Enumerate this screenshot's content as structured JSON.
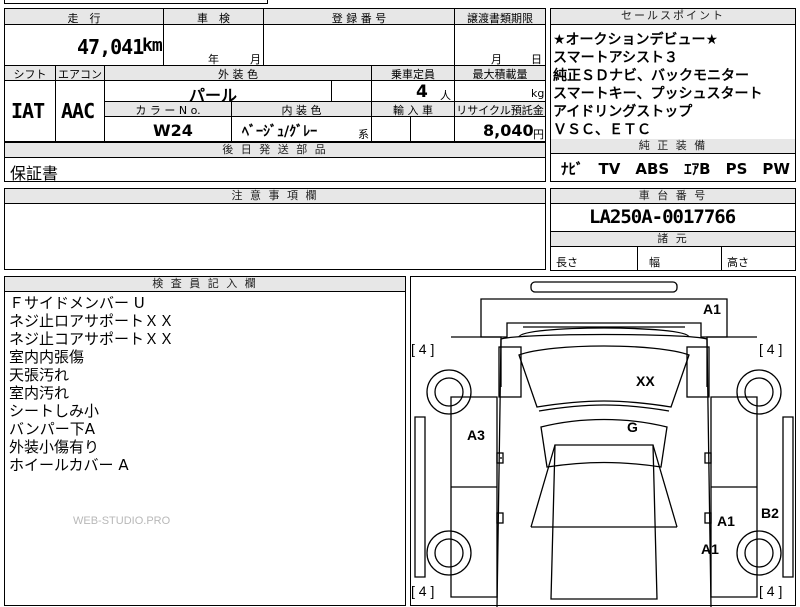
{
  "top_row": {
    "mileage_label": "走　行",
    "inspection_label": "車　検",
    "registration_label": "登 録 番 号",
    "transfer_label": "譲渡書類期限",
    "mileage_value": "47,041",
    "mileage_unit": "km",
    "inspection_year_label": "年",
    "inspection_month_label": "月",
    "transfer_month_label": "月",
    "transfer_day_label": "日"
  },
  "row2": {
    "shift_label": "シフト",
    "aircon_label": "エアコン",
    "exterior_color_label": "外 装 色",
    "capacity_label": "乗車定員",
    "max_load_label": "最大積載量",
    "shift_value": "IAT",
    "aircon_value": "AAC",
    "exterior_color_value": "パール",
    "capacity_value": "4",
    "capacity_unit": "人",
    "max_load_unit": "kg",
    "color_no_label": "カ ラ ー N o.",
    "interior_label": "内 装 色",
    "import_label": "輸 入 車",
    "recycle_label": "リサイクル預託金",
    "color_no_value": "W24",
    "interior_value": "ﾍﾞｰｼﾞｭ/ｸﾞﾚｰ",
    "interior_suffix": "系",
    "recycle_value": "8,040",
    "recycle_unit": "円"
  },
  "later_parts": {
    "label": "後 日 発 送 部 品",
    "value": "保証書"
  },
  "caution": {
    "label": "注 意 事 項 欄"
  },
  "selling_points": {
    "label": "セールスポイント",
    "lines": [
      "★オークションデビュー★",
      "スマートアシスト３",
      "純正ＳＤナビ、バックモニター",
      "スマートキー、プッシュスタート",
      "アイドリングストップ",
      "ＶＳＣ、ＥＴＣ"
    ]
  },
  "equipment": {
    "label": "純 正 装 備",
    "value": "ﾅﾋﾞ　TV　ABS　ｴｱB　PS　PW"
  },
  "chassis": {
    "label": "車 台 番 号",
    "value": "LA250A-0017766"
  },
  "dimensions": {
    "label": "諸 元",
    "length_label": "長さ",
    "width_label": "幅",
    "height_label": "高さ"
  },
  "inspector": {
    "label": "検 査 員 記 入 欄",
    "notes": [
      "Ｆサイドメンバー U",
      "ネジ止ロアサポートＸＸ",
      "ネジ止コアサポートＸＸ",
      "室内内張傷",
      "天張汚れ",
      "室内汚れ",
      "シートしみ小",
      "バンパー下A",
      "外装小傷有り",
      "ホイールカバー A"
    ],
    "watermark": "WEB-STUDIO.PRO"
  },
  "diagram": {
    "tire_marks": [
      "[ 4 ]",
      "[ 4 ]",
      "[ 4 ]",
      "[ 4 ]"
    ],
    "damage_marks": [
      "A1",
      "XX",
      "A3",
      "G",
      "A1",
      "B2",
      "A1"
    ]
  }
}
